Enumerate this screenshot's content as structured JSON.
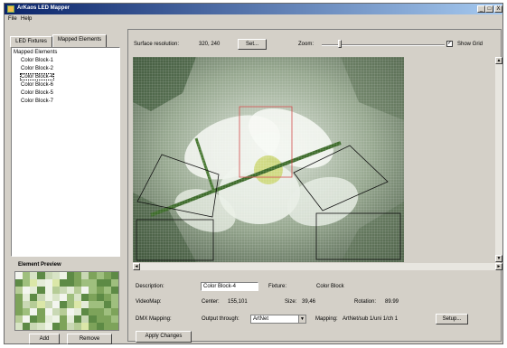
{
  "window": {
    "title": "ArKaos LED Mapper",
    "controls": [
      "_",
      "□",
      "X"
    ]
  },
  "menu": [
    "File",
    "Help"
  ],
  "left": {
    "tabs": [
      "LED Fixtures",
      "Mapped Elements"
    ],
    "list_root": "Mapped Elements",
    "list_items": [
      "Color Block-1",
      "Color Block-2",
      "Color Block-4",
      "Color Block-6",
      "Color Block-5",
      "Color Block-7"
    ],
    "selected_index": 2,
    "preview_title": "Element Preview",
    "add_label": "Add",
    "remove_label": "Remove"
  },
  "toolbar": {
    "surface_label": "Surface resolution:",
    "surface_value": "320, 240",
    "set_label": "Set...",
    "zoom_label": "Zoom:",
    "show_grid_label": "Show Grid",
    "show_grid_checked": true
  },
  "details": {
    "description_label": "Description:",
    "description_value": "Color Block-4",
    "fixture_label": "Fixture:",
    "fixture_value": "Color Block",
    "videomap_label": "VideoMap:",
    "center_label": "Center:",
    "center_value": "155,101",
    "size_label": "Size:",
    "size_value": "39,46",
    "rotation_label": "Rotation:",
    "rotation_value": "89.99",
    "dmx_label": "DMX Mapping:",
    "output_label": "Output through:",
    "output_value": "ArtNet",
    "mapping_label": "Mapping:",
    "mapping_value": "ArtNet/sub 1/uni 1/ch 1",
    "setup_label": "Setup...",
    "apply_label": "Apply Changes"
  }
}
